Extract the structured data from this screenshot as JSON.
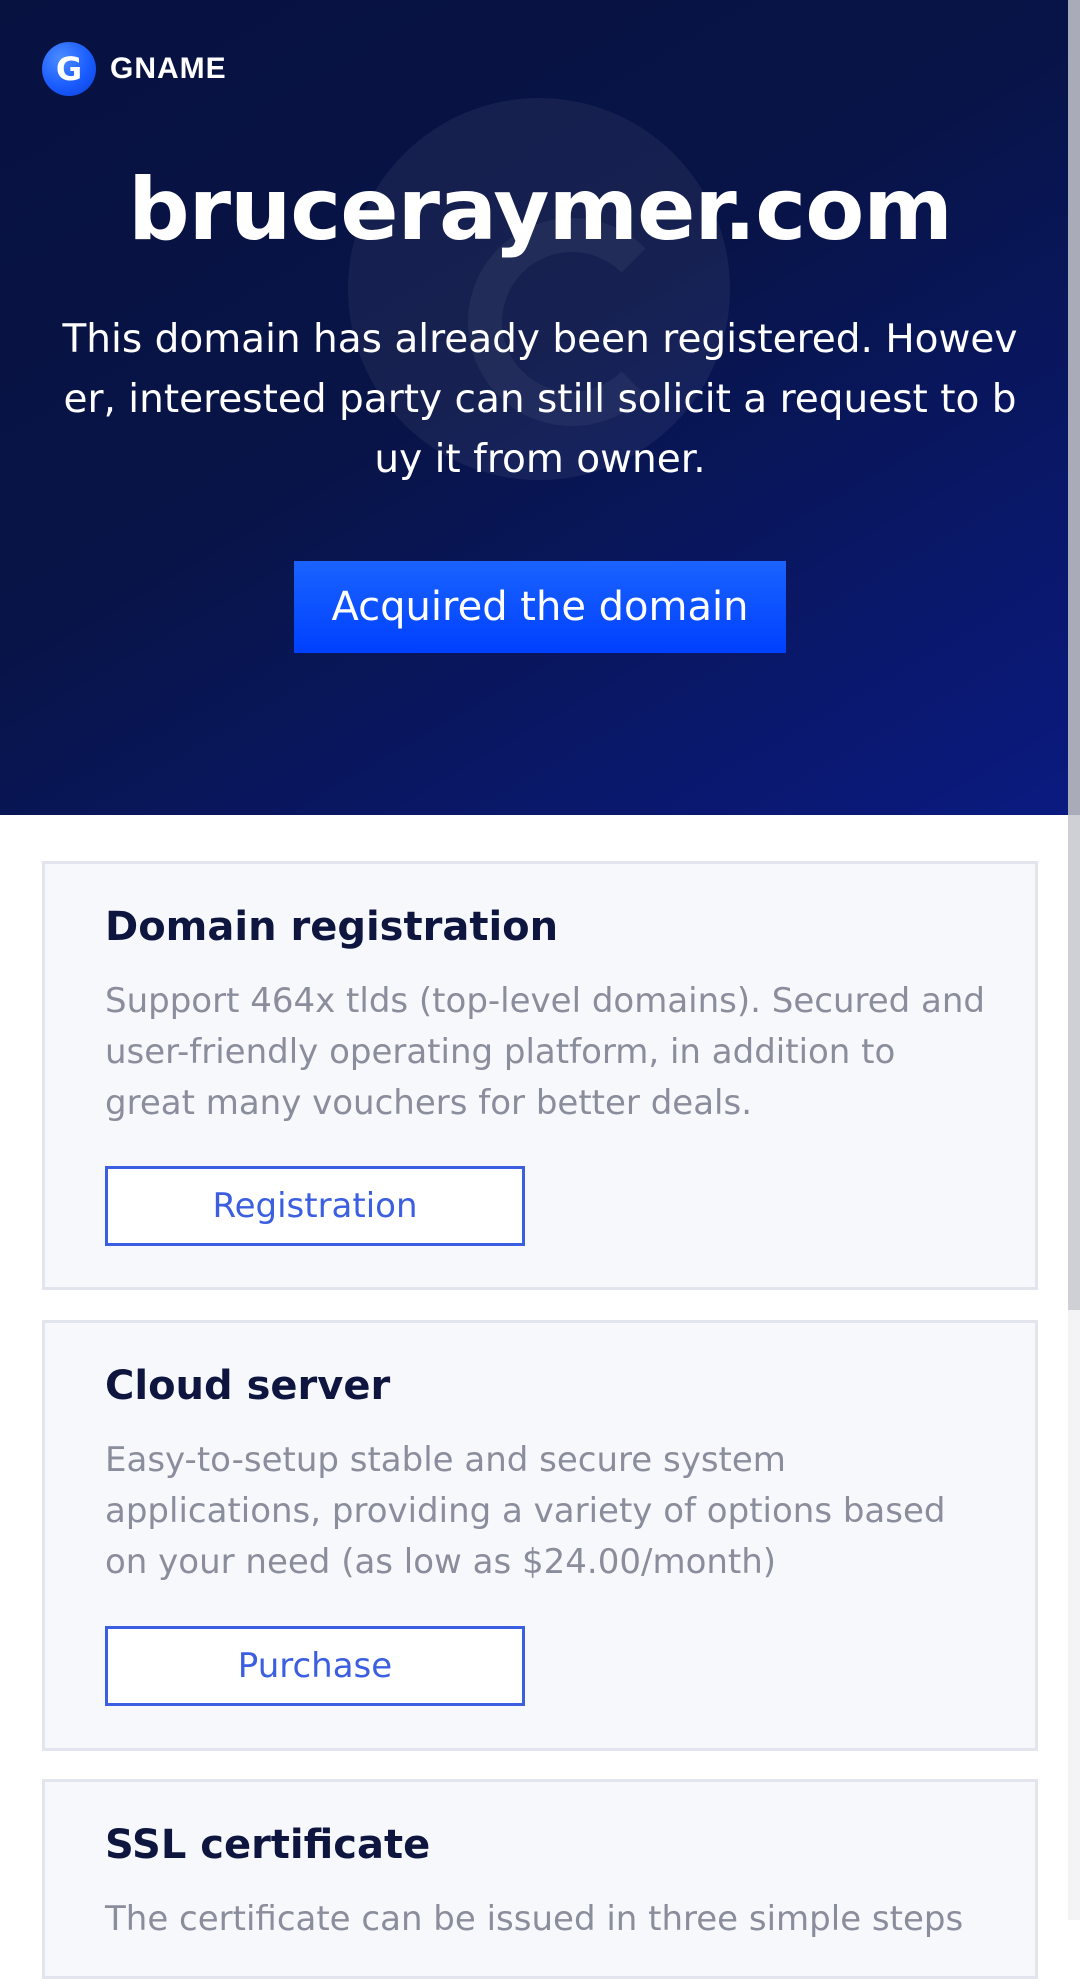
{
  "brand": {
    "logo_letter": "G",
    "name": "GNAME"
  },
  "hero": {
    "domain": "bruceraymer.com",
    "description": "This domain has already been registered. However, interested party can still solicit a request to buy it from owner.",
    "button_label": "Acquired the domain"
  },
  "services": [
    {
      "title": "Domain registration",
      "description": "Support 464x tlds (top-level domains). Secured and user-friendly operating platform, in addition to great many vouchers for better deals.",
      "button_label": "Registration"
    },
    {
      "title": "Cloud server",
      "description": "Easy-to-setup stable and secure system applications, providing a variety of options based on your need (as low as $24.00/month)",
      "button_label": "Purchase"
    },
    {
      "title": "SSL certificate",
      "description": "The certificate can be issued in three simple steps"
    }
  ],
  "colors": {
    "hero_background": "#081447",
    "accent": "#0040ff",
    "link_blue": "#3b5fe0",
    "card_background": "#f7f8fc"
  }
}
